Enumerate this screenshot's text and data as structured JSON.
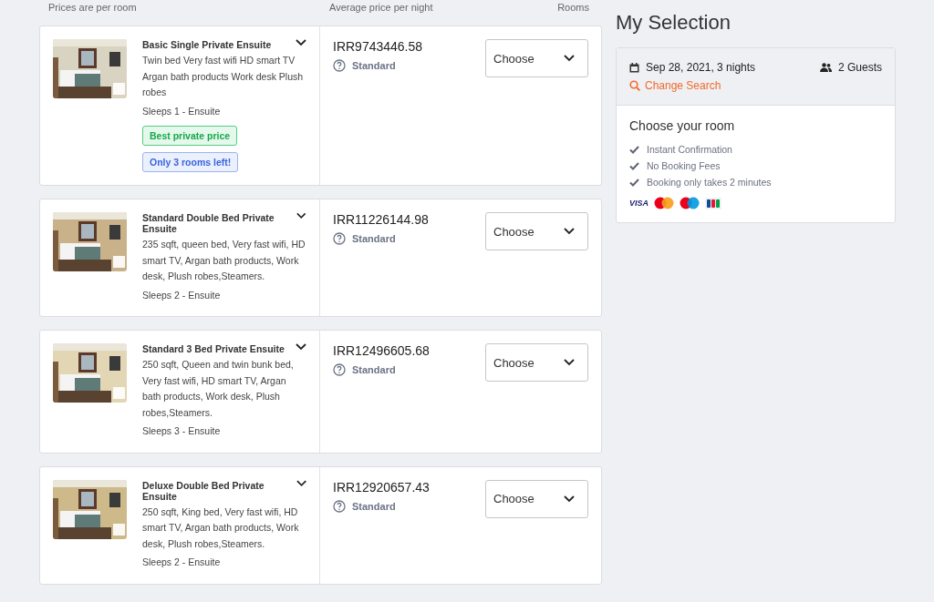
{
  "table_header": {
    "column_1": "Prices are per room",
    "column_2": "Average price per night",
    "column_3": "Rooms"
  },
  "rooms": [
    {
      "name": "Basic Single Private Ensuite",
      "description": "Twin bed Very fast wifi HD smart TV Argan bath products Work desk Plush robes",
      "sleeps": "Sleeps 1 - Ensuite",
      "badges": [
        {
          "label": "Best private price",
          "kind": "success"
        },
        {
          "label": "Only 3 rooms left!",
          "kind": "info"
        }
      ],
      "price": "IRR9743446.58",
      "rate": "Standard",
      "select": "Choose"
    },
    {
      "name": "Standard Double Bed Private Ensuite",
      "description": "235 sqft, queen bed, Very fast wifi, HD smart TV, Argan bath products, Work desk, Plush robes,Steamers.",
      "sleeps": "Sleeps 2 - Ensuite",
      "price": "IRR11226144.98",
      "rate": "Standard",
      "select": "Choose"
    },
    {
      "name": "Standard 3 Bed Private Ensuite",
      "description": "250 sqft, Queen and twin bunk bed, Very fast wifi, HD smart TV, Argan bath products, Work desk, Plush robes,Steamers.",
      "sleeps": "Sleeps 3 - Ensuite",
      "price": "IRR12496605.68",
      "rate": "Standard",
      "select": "Choose"
    },
    {
      "name": "Deluxe Double Bed Private Ensuite",
      "description": "250 sqft, King bed, Very fast wifi, HD smart TV, Argan bath products, Work desk, Plush robes,Steamers.",
      "sleeps": "Sleeps 2 - Ensuite",
      "price": "IRR12920657.43",
      "rate": "Standard",
      "select": "Choose"
    }
  ],
  "selection": {
    "title": "My Selection",
    "dates": "Sep 28, 2021, 3 nights",
    "guests": "2 Guests",
    "change_link": "Change Search",
    "heading": "Choose your room",
    "benefits": [
      "Instant Confirmation",
      "No Booking Fees",
      "Booking only takes 2 minutes"
    ],
    "payment_cards": [
      {
        "kind": "visa",
        "label": "VISA"
      },
      {
        "kind": "mastercard"
      },
      {
        "kind": "maestro"
      },
      {
        "kind": "jcb"
      }
    ]
  }
}
